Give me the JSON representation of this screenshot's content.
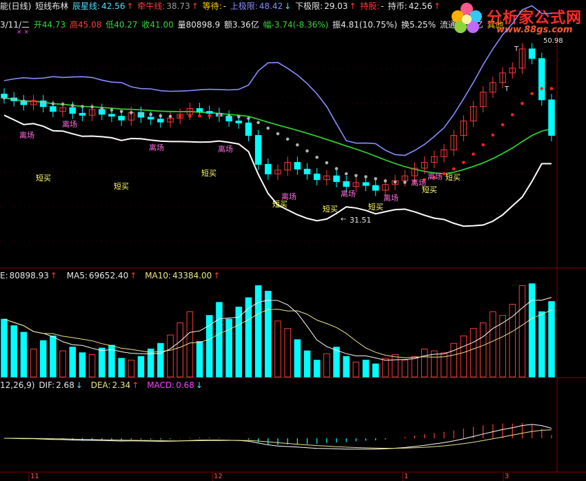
{
  "colors": {
    "bg": "#000000",
    "grid": "#8b0000",
    "up": "#ff3b3b",
    "down": "#00ffff",
    "boll_upper": "#8a8dff",
    "boll_lower": "#ffffff",
    "ma_green": "#2ecc2e",
    "dif": "#ffffff",
    "dea": "#f0e68c",
    "macd": "#ff40ff"
  },
  "title_bar": {
    "prefix": "能(日线)",
    "indicator": "短线布林",
    "items": [
      {
        "label": "辰星线:",
        "value": "42.56",
        "arrow": "↑"
      },
      {
        "label": "牵牛线:",
        "value": "38.73",
        "arrow": "↑"
      },
      {
        "label": "等待:",
        "value": "-",
        "arrow": ""
      },
      {
        "label": "上极限:",
        "value": "48.42",
        "arrow": "↓"
      },
      {
        "label": "下极限:",
        "value": "29.03",
        "arrow": "↑"
      },
      {
        "label": "持股:",
        "value": "-",
        "arrow": ""
      },
      {
        "label": "持币:",
        "value": "42.56",
        "arrow": "↑"
      }
    ]
  },
  "quote_bar": {
    "date": "3/11/二",
    "open": "开44.73",
    "high": "高45.08",
    "low": "低40.27",
    "close": "收41.00",
    "volume": "量80898.9",
    "amount": "额3.36亿",
    "change": "幅-3.74(-8.36%)",
    "amplitude": "振4.81(10.75%)",
    "turnover": "换5.25%",
    "float_cap": "流通1.54亿",
    "other": "其他"
  },
  "logo": {
    "title": "分析家公式网",
    "url": "www.88gs.com"
  },
  "price_panel": {
    "high_label": "50.98",
    "low_label": "31.51",
    "low_arrow": "←",
    "sell_tag": "离场",
    "buy_tag": "短买",
    "top_markers": [
      "T",
      "T"
    ]
  },
  "volume_panel": {
    "label_prefix": "E:",
    "vol": "80898.93",
    "ma5_label": "MA5:",
    "ma5": "69652.40",
    "ma10_label": "MA10:",
    "ma10": "43384.00",
    "arrow": "↑"
  },
  "macd_panel": {
    "params": "12,26,9)",
    "dif_label": "DIF:",
    "dif": "2.68",
    "dif_arrow": "↓",
    "dea_label": "DEA:",
    "dea": "2.34",
    "dea_arrow": "↑",
    "macd_label": "MACD:",
    "macd": "0.68",
    "macd_arrow": "↓"
  },
  "x_axis": {
    "ticks": [
      "11",
      "12",
      "1",
      "3"
    ]
  },
  "chart_data": {
    "type": "candlestick",
    "price_closes": [
      44.9,
      44.6,
      44.2,
      44.6,
      44.0,
      43.5,
      43.9,
      43.3,
      43.1,
      43.7,
      43.2,
      43.0,
      42.6,
      43.4,
      42.9,
      42.7,
      42.4,
      42.8,
      43.2,
      43.8,
      43.5,
      43.3,
      43.0,
      42.5,
      42.3,
      41.0,
      38.0,
      37.0,
      37.4,
      38.2,
      37.5,
      37.0,
      36.4,
      36.8,
      36.2,
      35.7,
      36.1,
      35.8,
      35.3,
      35.9,
      36.3,
      36.8,
      37.6,
      38.2,
      38.8,
      39.5,
      41.0,
      42.5,
      44.0,
      45.5,
      46.5,
      47.5,
      48.0,
      50.0,
      49.0,
      44.7,
      41.0
    ],
    "volume": [
      62000,
      55000,
      48000,
      30000,
      39000,
      44000,
      28000,
      32000,
      26000,
      24000,
      31000,
      34000,
      20000,
      18000,
      22000,
      30000,
      36000,
      45000,
      58000,
      70000,
      38000,
      66000,
      80000,
      62000,
      75000,
      85000,
      98000,
      92000,
      60000,
      52000,
      40000,
      28000,
      18000,
      25000,
      32000,
      22000,
      16000,
      18000,
      14000,
      20000,
      24000,
      18000,
      22000,
      30000,
      28000,
      26000,
      36000,
      44000,
      52000,
      58000,
      70000,
      66000,
      78000,
      98000,
      100000,
      70000,
      80898.93
    ],
    "macd_ticks": [
      "12,26,9"
    ]
  }
}
